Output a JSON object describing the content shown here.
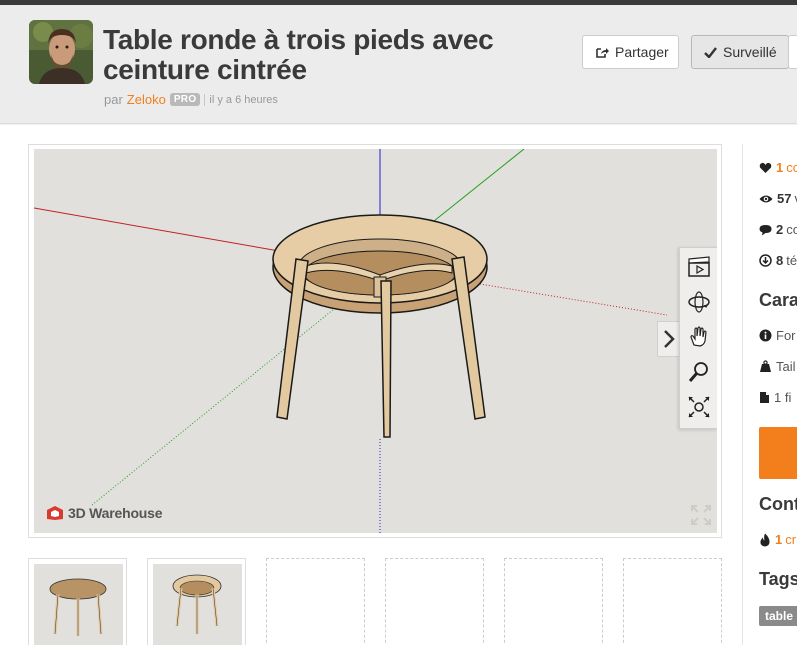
{
  "header": {
    "title": "Table ronde à trois pieds avec ceinture cintrée",
    "by_prefix": "par",
    "author": "Zeloko",
    "badge": "PRO",
    "timestamp": "il y a 6 heures",
    "share_label": "Partager",
    "watch_label": "Surveillé"
  },
  "viewer": {
    "brand": "3D Warehouse",
    "tools": [
      "scenes-icon",
      "orbit-icon",
      "pan-icon",
      "zoom-icon",
      "zoom-extents-icon"
    ]
  },
  "thumbnails": {
    "filled": 2,
    "empty": 4
  },
  "sidebar": {
    "stats": [
      {
        "icon": "heart-icon",
        "num": "1",
        "rest": "co"
      },
      {
        "icon": "eye-icon",
        "num": "57",
        "rest": "v"
      },
      {
        "icon": "comment-icon",
        "num": "2",
        "rest": "co"
      },
      {
        "icon": "download-icon",
        "num": "8",
        "rest": "té"
      }
    ],
    "characteristics_title": "Cara",
    "info_rows": [
      {
        "icon": "info-icon",
        "text": "For"
      },
      {
        "icon": "weight-icon",
        "text": "Tail"
      },
      {
        "icon": "file-icon",
        "text": "1 fi"
      }
    ],
    "contributors_title": "Cont",
    "contributor": {
      "icon": "flame-icon",
      "num": "1",
      "rest": "cr"
    },
    "tags_title": "Tags",
    "tags": [
      "table"
    ]
  },
  "colors": {
    "accent": "#f27f1b",
    "header_bg": "#ececec",
    "viewer_bg": "#e2e0dc",
    "wood": "#e3c9a0"
  }
}
